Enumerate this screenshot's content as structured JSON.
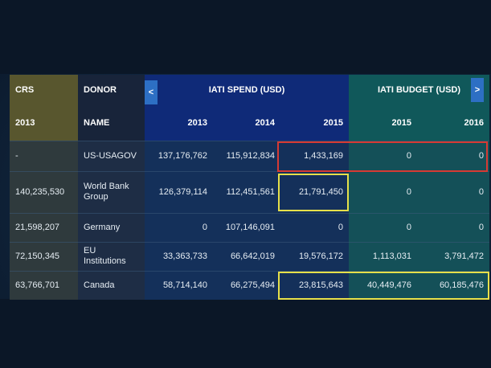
{
  "columns": {
    "crs": {
      "top": "CRS",
      "sub": "2013"
    },
    "donor": {
      "top": "DONOR",
      "sub": "NAME"
    },
    "spend": {
      "title": "IATI SPEND (USD)",
      "years": [
        "2013",
        "2014",
        "2015"
      ],
      "prev_arrow": "<"
    },
    "budget": {
      "title": "IATI BUDGET (USD)",
      "years": [
        "2015",
        "2016"
      ],
      "next_arrow": ">"
    }
  },
  "rows": [
    {
      "crs": "-",
      "donor": "US-USAGOV",
      "spend": [
        "137,176,762",
        "115,912,834",
        "1,433,169"
      ],
      "budget": [
        "0",
        "0"
      ]
    },
    {
      "crs": "140,235,530",
      "donor": "World Bank Group",
      "spend": [
        "126,379,114",
        "112,451,561",
        "21,791,450"
      ],
      "budget": [
        "0",
        "0"
      ]
    },
    {
      "crs": "21,598,207",
      "donor": "Germany",
      "spend": [
        "0",
        "107,146,091",
        "0"
      ],
      "budget": [
        "0",
        "0"
      ]
    },
    {
      "crs": "72,150,345",
      "donor": "EU Institutions",
      "spend": [
        "33,363,733",
        "66,642,019",
        "19,576,172"
      ],
      "budget": [
        "1,113,031",
        "3,791,472"
      ]
    },
    {
      "crs": "63,766,701",
      "donor": "Canada",
      "spend": [
        "58,714,140",
        "66,275,494",
        "23,815,643"
      ],
      "budget": [
        "40,449,476",
        "60,185,476"
      ]
    }
  ],
  "highlight_colors": {
    "red": "#d63a34",
    "yellow": "#e6e04a"
  }
}
